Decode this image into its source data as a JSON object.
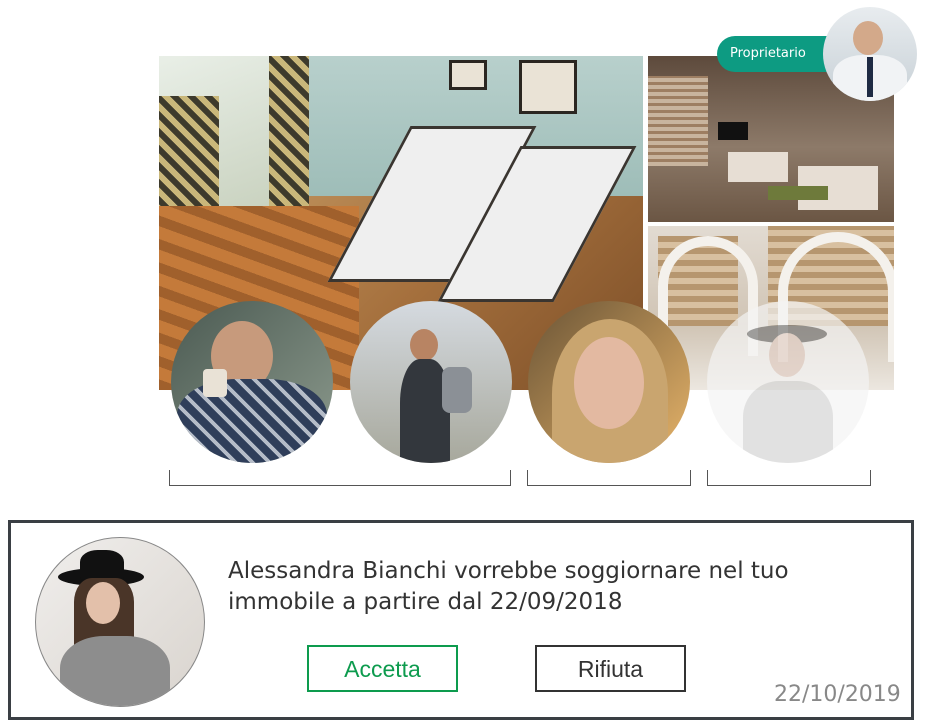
{
  "owner": {
    "badge_label": "Proprietario"
  },
  "guests": [
    {
      "name": "guest-man-glasses"
    },
    {
      "name": "guest-man-backpack"
    },
    {
      "name": "guest-woman-blonde"
    },
    {
      "name": "guest-woman-hat-faded"
    }
  ],
  "request": {
    "message": "Alessandra Bianchi vorrebbe soggiornare nel tuo immobile a partire dal 22/09/2018",
    "accept_label": "Accetta",
    "reject_label": "Rifiuta",
    "date": "22/10/2019"
  },
  "colors": {
    "accent": "#0d9b82",
    "accept": "#0d9b4e",
    "card_border": "#3a3f44"
  }
}
